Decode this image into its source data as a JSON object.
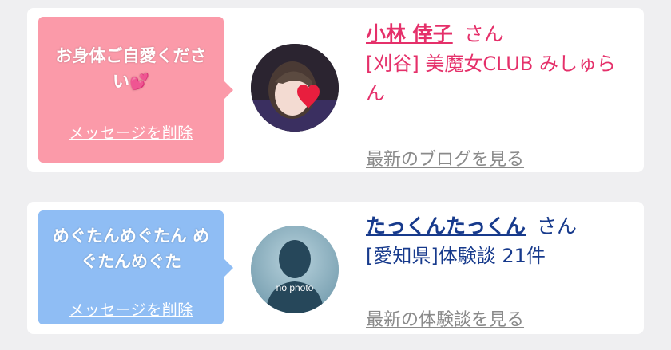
{
  "messages": [
    {
      "text": "お身体ご自愛くださ い",
      "heart": "💕",
      "delete_label": "メッセージを削除",
      "user_name": "小林 倖子",
      "honorific": "さん",
      "shop": "[刈谷] 美魔女CLUB みしゅらん",
      "link_label": "最新のブログを見る",
      "bubble_color": "#fb9aa9",
      "accent_color": "#e5306a"
    },
    {
      "text": "めぐたんめぐたん めぐたんめぐた",
      "delete_label": "メッセージを削除",
      "user_name": "たっくんたっくん",
      "honorific": "さん",
      "shop": "[愛知県]体験談 21件",
      "link_label": "最新の体験談を見る",
      "avatar_text": "no photo",
      "bubble_color": "#8fbdf4",
      "accent_color": "#173a8c"
    }
  ]
}
